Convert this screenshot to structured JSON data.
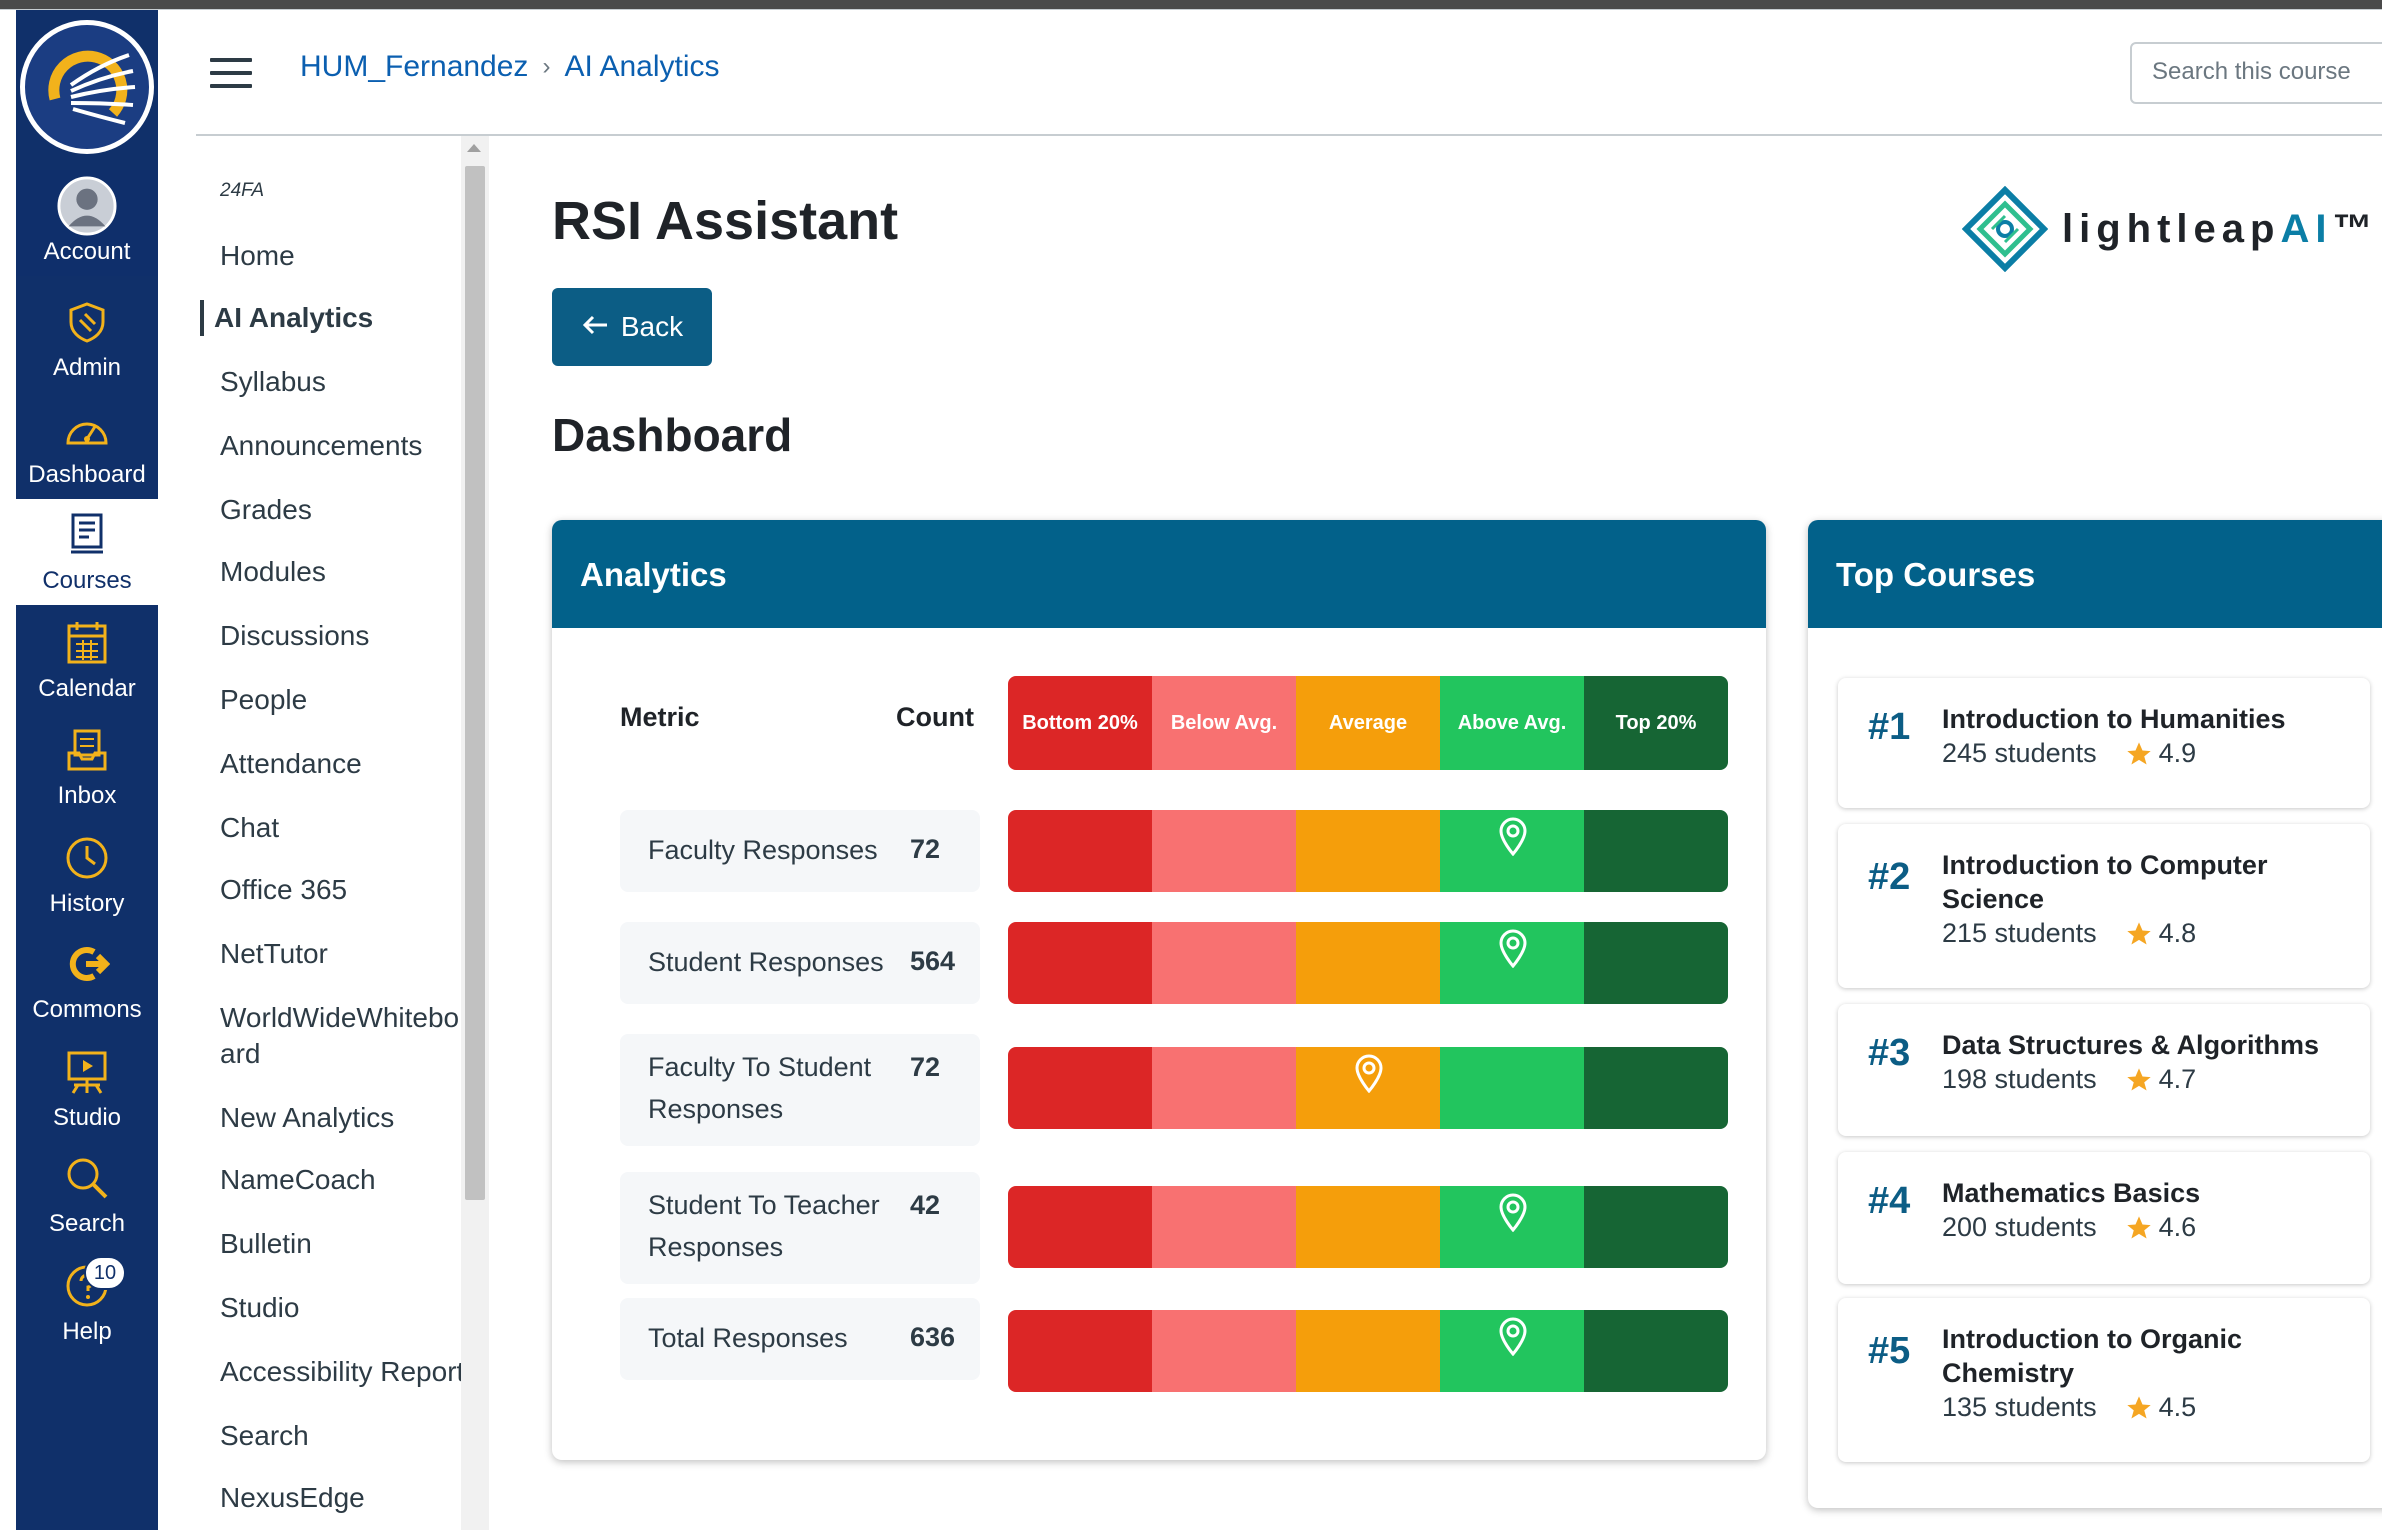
{
  "global_nav": {
    "items": [
      {
        "label": "Account",
        "icon": "user-avatar-icon"
      },
      {
        "label": "Admin",
        "icon": "shield-icon"
      },
      {
        "label": "Dashboard",
        "icon": "dashboard-gauge-icon"
      },
      {
        "label": "Courses",
        "icon": "book-icon"
      },
      {
        "label": "Calendar",
        "icon": "calendar-icon"
      },
      {
        "label": "Inbox",
        "icon": "inbox-icon"
      },
      {
        "label": "History",
        "icon": "clock-icon"
      },
      {
        "label": "Commons",
        "icon": "commons-arrow-icon"
      },
      {
        "label": "Studio",
        "icon": "studio-screen-icon"
      },
      {
        "label": "Search",
        "icon": "magnifier-icon"
      },
      {
        "label": "Help",
        "icon": "question-icon",
        "badge": "10"
      }
    ],
    "active": "Courses"
  },
  "header": {
    "breadcrumb": [
      "HUM_Fernandez",
      "AI Analytics"
    ],
    "search_placeholder": "Search this course"
  },
  "course_nav": {
    "term": "24FA",
    "links": [
      "Home",
      "AI Analytics",
      "Syllabus",
      "Announcements",
      "Grades",
      "Modules",
      "Discussions",
      "People",
      "Attendance",
      "Chat",
      "Office 365",
      "NetTutor",
      "WorldWideWhitebo\nard",
      "New Analytics",
      "NameCoach",
      "Bulletin",
      "Studio",
      "Accessibility Report",
      "Search",
      "NexusEdge"
    ],
    "active": "AI Analytics"
  },
  "main": {
    "title": "RSI Assistant",
    "brand": {
      "prefix": "lightleap",
      "suffix": "AI",
      "mark": "™"
    },
    "back_label": "Back",
    "section_title": "Dashboard"
  },
  "analytics": {
    "title": "Analytics",
    "col_metric": "Metric",
    "col_count": "Count",
    "legend": [
      {
        "label": "Bottom 20%",
        "color": "#dc2626"
      },
      {
        "label": "Below Avg.",
        "color": "#f87171"
      },
      {
        "label": "Average",
        "color": "#f59e0b"
      },
      {
        "label": "Above Avg.",
        "color": "#22c55e"
      },
      {
        "label": "Top 20%",
        "color": "#166534"
      }
    ],
    "metrics": [
      {
        "name": "Faculty Responses",
        "count": "72",
        "band": "Above Avg."
      },
      {
        "name": "Student Responses",
        "count": "564",
        "band": "Above Avg."
      },
      {
        "name": "Faculty To Student Responses",
        "count": "72",
        "band": "Average"
      },
      {
        "name": "Student To Teacher Responses",
        "count": "42",
        "band": "Above Avg."
      },
      {
        "name": "Total Responses",
        "count": "636",
        "band": "Above Avg."
      }
    ]
  },
  "top_courses": {
    "title": "Top Courses",
    "items": [
      {
        "rank": "#1",
        "name": "Introduction to Humanities",
        "students": "245 students",
        "rating": "4.9"
      },
      {
        "rank": "#2",
        "name": "Introduction to Computer Science",
        "students": "215 students",
        "rating": "4.8"
      },
      {
        "rank": "#3",
        "name": "Data Structures & Algorithms",
        "students": "198 students",
        "rating": "4.7"
      },
      {
        "rank": "#4",
        "name": "Mathematics Basics",
        "students": "200 students",
        "rating": "4.6"
      },
      {
        "rank": "#5",
        "name": "Introduction to Organic Chemistry",
        "students": "135 students",
        "rating": "4.5"
      }
    ]
  }
}
